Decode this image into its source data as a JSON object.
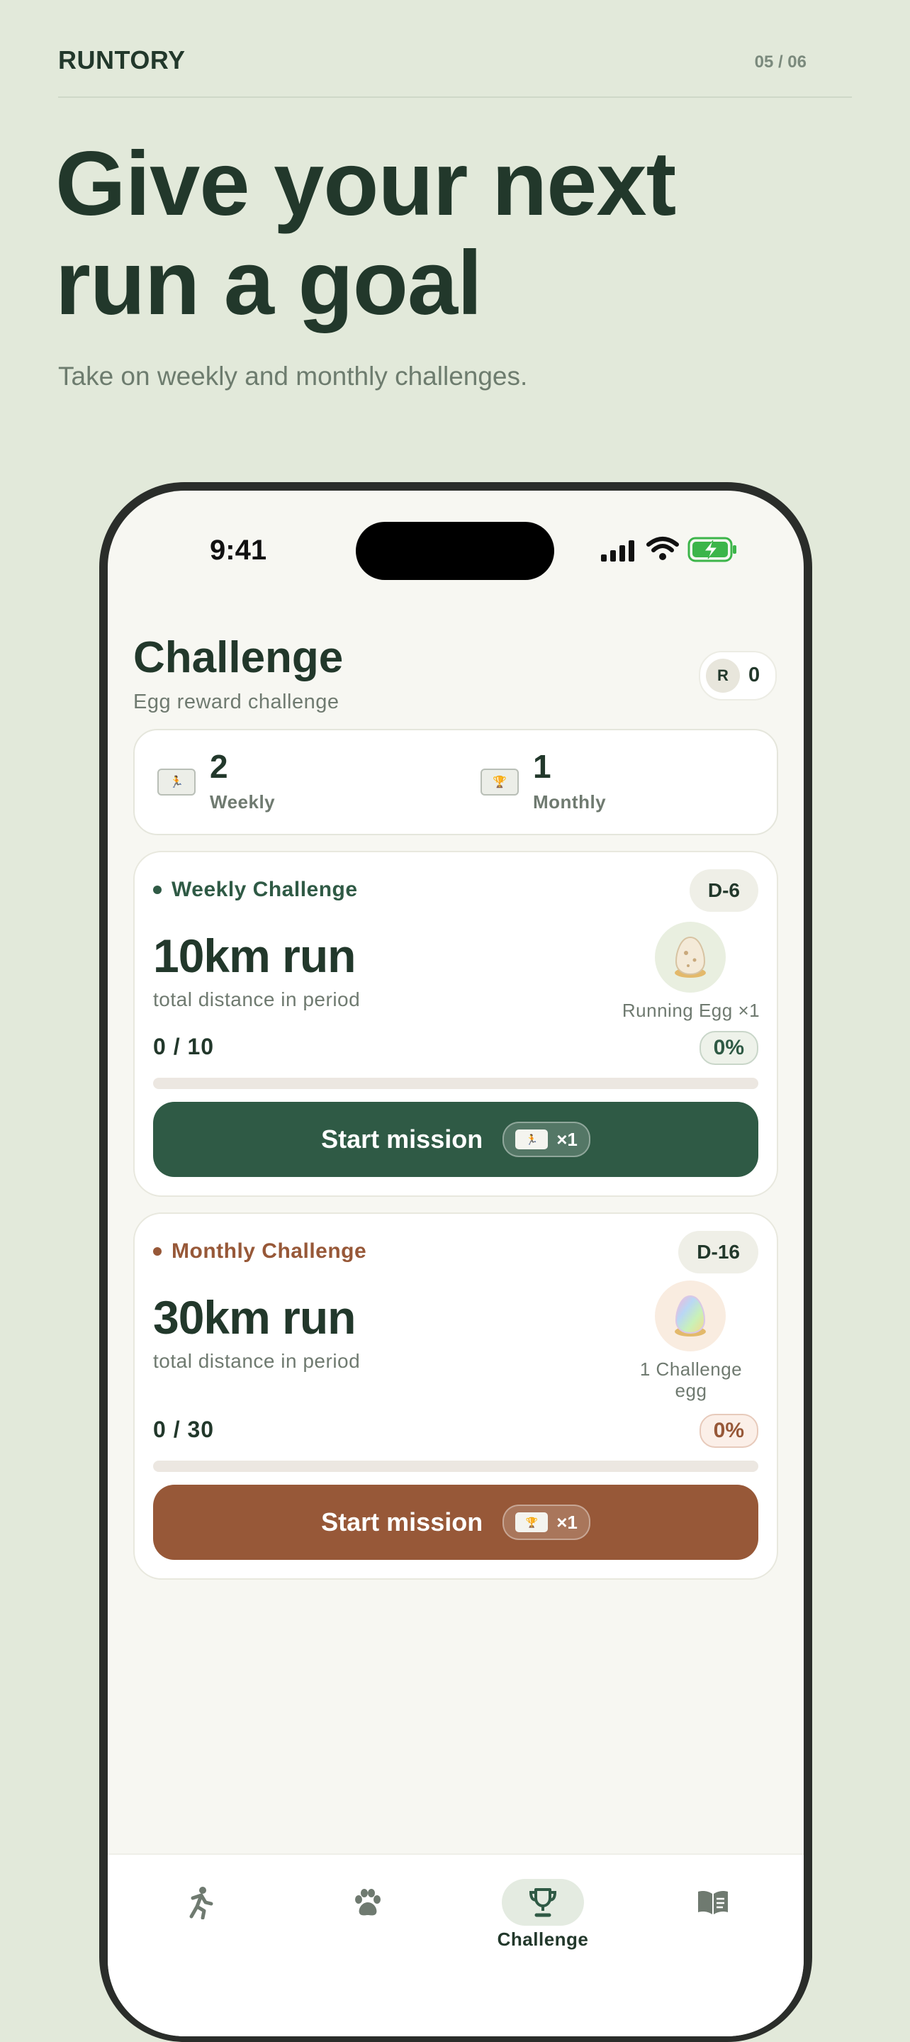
{
  "brand": "RUNTORY",
  "pager": "05 / 06",
  "headline": [
    "Give your next",
    "run a goal"
  ],
  "subline": "Take on weekly and monthly challenges.",
  "status_bar": {
    "time": "9:41",
    "icons": [
      "signal-icon",
      "wifi-icon",
      "battery-charging-icon"
    ]
  },
  "screen": {
    "title": "Challenge",
    "subtitle": "Egg reward challenge",
    "coin": {
      "symbol": "R",
      "value": "0"
    },
    "summary": [
      {
        "icon": "running-ticket-icon",
        "count": "2",
        "label": "Weekly"
      },
      {
        "icon": "trophy-ticket-icon",
        "count": "1",
        "label": "Monthly"
      }
    ],
    "challenges": [
      {
        "kind": "Weekly Challenge",
        "dday": "D-6",
        "goal": "10km run",
        "description": "total distance in period",
        "reward_label": "Running Egg ×1",
        "progress_text": "0 / 10",
        "percent_label": "0%",
        "progress": 0,
        "button_label": "Start mission",
        "ticket_icon": "running-ticket-icon",
        "ticket_count": "×1",
        "accent": "#2f5a45"
      },
      {
        "kind": "Monthly Challenge",
        "dday": "D-16",
        "goal": "30km run",
        "description": "total distance in period",
        "reward_label": "1 Challenge egg",
        "progress_text": "0 / 30",
        "percent_label": "0%",
        "progress": 0,
        "button_label": "Start mission",
        "ticket_icon": "trophy-ticket-icon",
        "ticket_count": "×1",
        "accent": "#975838"
      }
    ],
    "tabs": [
      {
        "icon": "running-icon",
        "label": "",
        "active": false
      },
      {
        "icon": "paw-icon",
        "label": "",
        "active": false
      },
      {
        "icon": "trophy-icon",
        "label": "Challenge",
        "active": true
      },
      {
        "icon": "book-icon",
        "label": "",
        "active": false
      }
    ]
  }
}
